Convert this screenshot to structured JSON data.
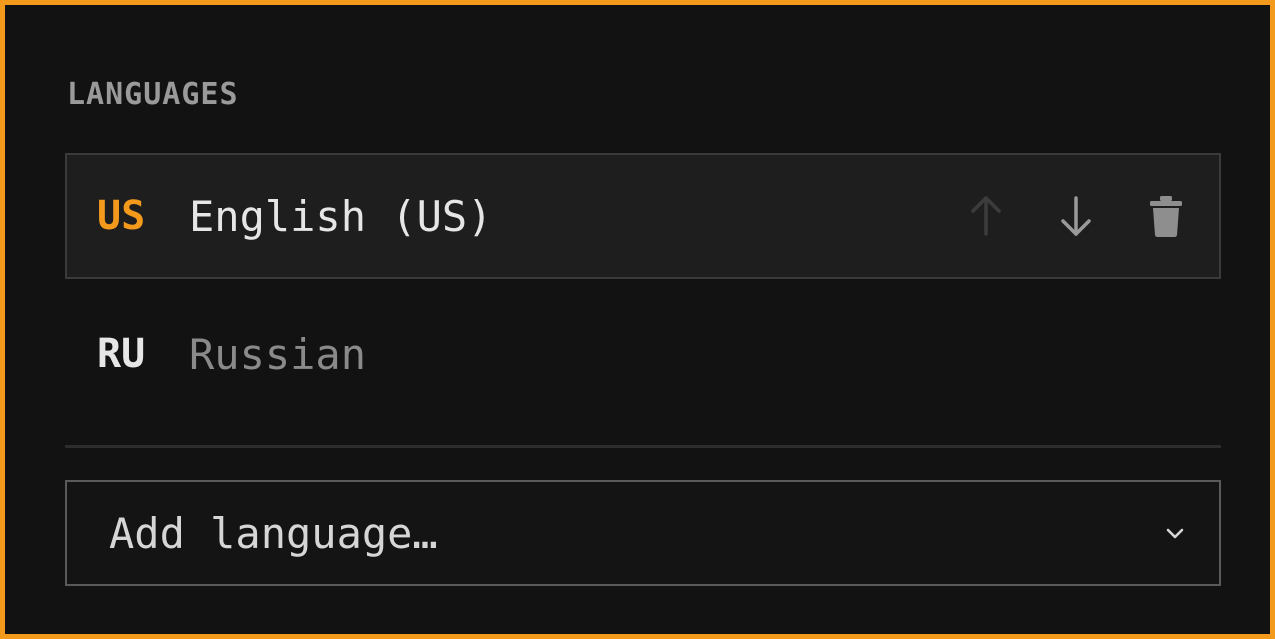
{
  "section": {
    "title": "LANGUAGES"
  },
  "languages": [
    {
      "code": "US",
      "name": "English (US)",
      "selected": true,
      "actions": {
        "move_up_icon": "arrow-up-icon",
        "move_up_enabled": false,
        "move_down_icon": "arrow-down-icon",
        "move_down_enabled": true,
        "delete_icon": "trash-icon"
      }
    },
    {
      "code": "RU",
      "name": "Russian",
      "selected": false
    }
  ],
  "add_language": {
    "placeholder": "Add language…",
    "icon": "chevron-down-icon"
  },
  "colors": {
    "accent": "#f39a1c",
    "background": "#121212",
    "selected_row_bg": "#1e1e1e",
    "title_text": "#9a9a9a",
    "primary_text": "#e6e6e6",
    "muted_text": "#8a8a8a",
    "disabled_icon": "#3c3c3c",
    "icon": "#9a9a9a"
  }
}
